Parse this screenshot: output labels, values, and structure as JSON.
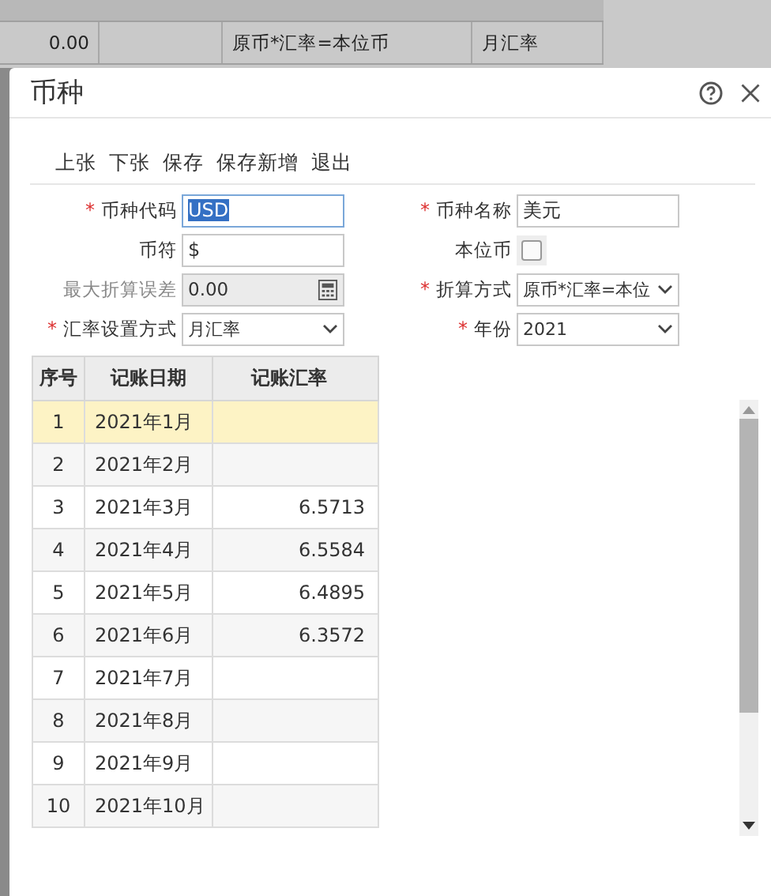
{
  "background_grid": {
    "row": {
      "column_1": "0.00",
      "column_3": "原币*汇率=本位币",
      "column_4": "月汇率"
    }
  },
  "dialog": {
    "title": "币种"
  },
  "toolbar": [
    "上张",
    "下张",
    "保存",
    "保存新增",
    "退出"
  ],
  "fields": [
    {
      "label": "币种代码",
      "kind": "text",
      "value": "USD",
      "required_mark": "*",
      "focused": true
    },
    {
      "label": "币种名称",
      "kind": "text",
      "value": "美元",
      "required_mark": "*"
    },
    {
      "label": "币符",
      "kind": "text",
      "value": "$"
    },
    {
      "label": "本位币",
      "kind": "checkbox",
      "checked": false
    },
    {
      "label": "最大折算误差",
      "kind": "number",
      "value": "0.00",
      "disabled": true
    },
    {
      "label": "折算方式",
      "kind": "select",
      "value": "原币*汇率=本位",
      "required_mark": "*"
    },
    {
      "label": "汇率设置方式",
      "kind": "select",
      "value": "月汇率",
      "required_mark": "*"
    },
    {
      "label": "年份",
      "kind": "select",
      "value": "2021",
      "required_mark": "*"
    }
  ],
  "table": {
    "columns": [
      "序号",
      "记账日期",
      "记账汇率"
    ],
    "rows": [
      {
        "cells": [
          "1",
          "2021年1月",
          ""
        ],
        "selected": true
      },
      {
        "cells": [
          "2",
          "2021年2月",
          ""
        ],
        "selected": false
      },
      {
        "cells": [
          "3",
          "2021年3月",
          "6.5713"
        ],
        "selected": false
      },
      {
        "cells": [
          "4",
          "2021年4月",
          "6.5584"
        ],
        "selected": false
      },
      {
        "cells": [
          "5",
          "2021年5月",
          "6.4895"
        ],
        "selected": false
      },
      {
        "cells": [
          "6",
          "2021年6月",
          "6.3572"
        ],
        "selected": false
      },
      {
        "cells": [
          "7",
          "2021年7月",
          ""
        ],
        "selected": false
      },
      {
        "cells": [
          "8",
          "2021年8月",
          ""
        ],
        "selected": false
      },
      {
        "cells": [
          "9",
          "2021年9月",
          ""
        ],
        "selected": false
      },
      {
        "cells": [
          "10",
          "2021年10月",
          ""
        ],
        "selected": false
      }
    ]
  }
}
